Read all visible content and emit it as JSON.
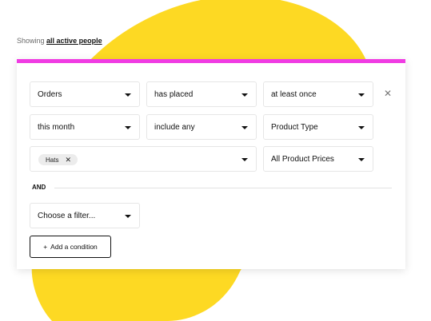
{
  "colors": {
    "accent": "#f03ce3",
    "blob": "#fdd923"
  },
  "header": {
    "prefix": "Showing",
    "link": "all active people"
  },
  "condition1": {
    "row1": {
      "subject": "Orders",
      "action": "has placed",
      "frequency": "at least once",
      "remove_icon": "close-icon"
    },
    "row2": {
      "time": "this month",
      "match": "include any",
      "attribute": "Product Type"
    },
    "row3": {
      "tags": [
        "Hats"
      ],
      "price": "All Product Prices"
    }
  },
  "connector": "AND",
  "condition2": {
    "placeholder": "Choose a filter..."
  },
  "add_button": {
    "icon": "+",
    "label": "Add a condition"
  }
}
